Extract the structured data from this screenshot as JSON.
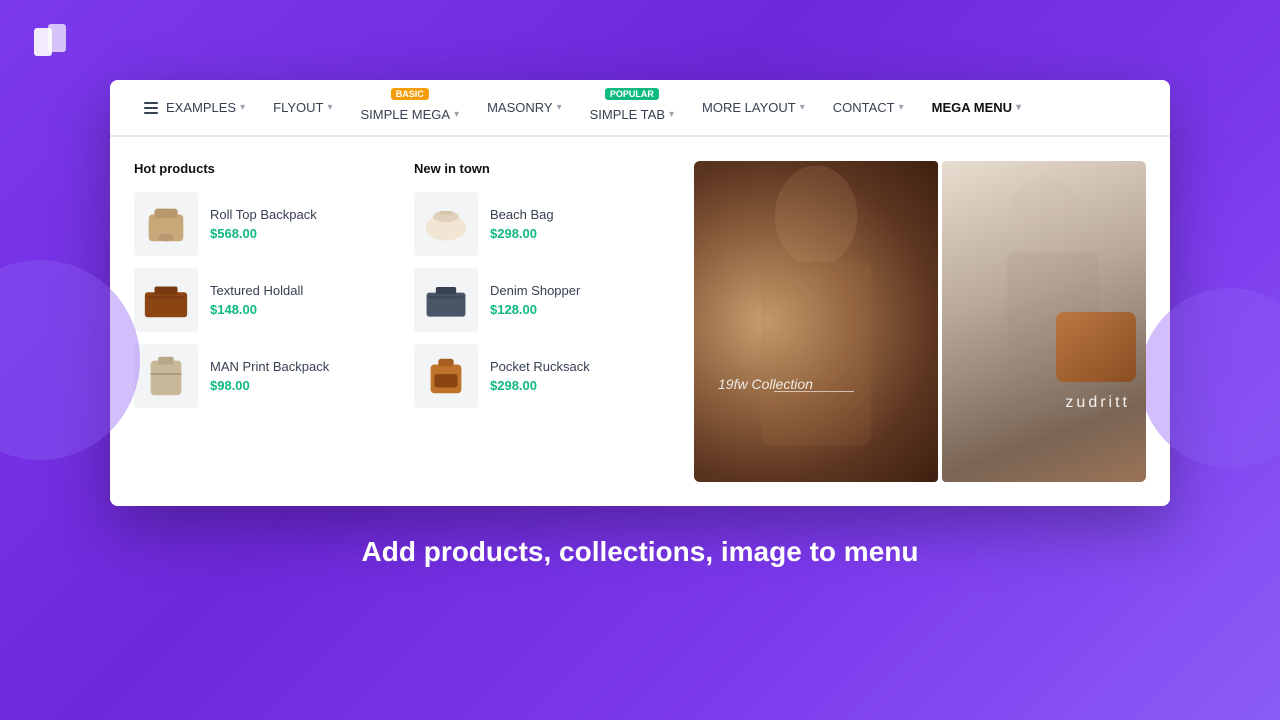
{
  "logo": {
    "alt": "App logo"
  },
  "navbar": {
    "items": [
      {
        "label": "EXAMPLES",
        "has_chevron": true,
        "badge": null
      },
      {
        "label": "FLYOUT",
        "has_chevron": true,
        "badge": null
      },
      {
        "label": "SIMPLE MEGA",
        "has_chevron": true,
        "badge": "BASIC",
        "badge_type": "basic"
      },
      {
        "label": "MASONRY",
        "has_chevron": true,
        "badge": null
      },
      {
        "label": "SIMPLE TAB",
        "has_chevron": true,
        "badge": "POPULAR",
        "badge_type": "popular"
      },
      {
        "label": "MORE LAYOUT",
        "has_chevron": true,
        "badge": null
      },
      {
        "label": "CONTACT",
        "has_chevron": true,
        "badge": null
      },
      {
        "label": "MEGA MENU",
        "has_chevron": true,
        "badge": null,
        "is_mega": true
      }
    ]
  },
  "mega_menu": {
    "hot_products": {
      "title": "Hot products",
      "items": [
        {
          "name": "Roll Top Backpack",
          "price": "$568.00",
          "img_type": "roll-top"
        },
        {
          "name": "Textured Holdall",
          "price": "$148.00",
          "img_type": "holdall"
        },
        {
          "name": "MAN Print Backpack",
          "price": "$98.00",
          "img_type": "man-print"
        }
      ]
    },
    "new_in_town": {
      "title": "New in town",
      "items": [
        {
          "name": "Beach Bag",
          "price": "$298.00",
          "img_type": "beach"
        },
        {
          "name": "Denim Shopper",
          "price": "$128.00",
          "img_type": "denim"
        },
        {
          "name": "Pocket Rucksack",
          "price": "$298.00",
          "img_type": "pocket"
        }
      ]
    },
    "images": {
      "left_text": "19fw Collection",
      "right_brand": "zudritt"
    }
  },
  "tagline": "Add products, collections, image to menu"
}
